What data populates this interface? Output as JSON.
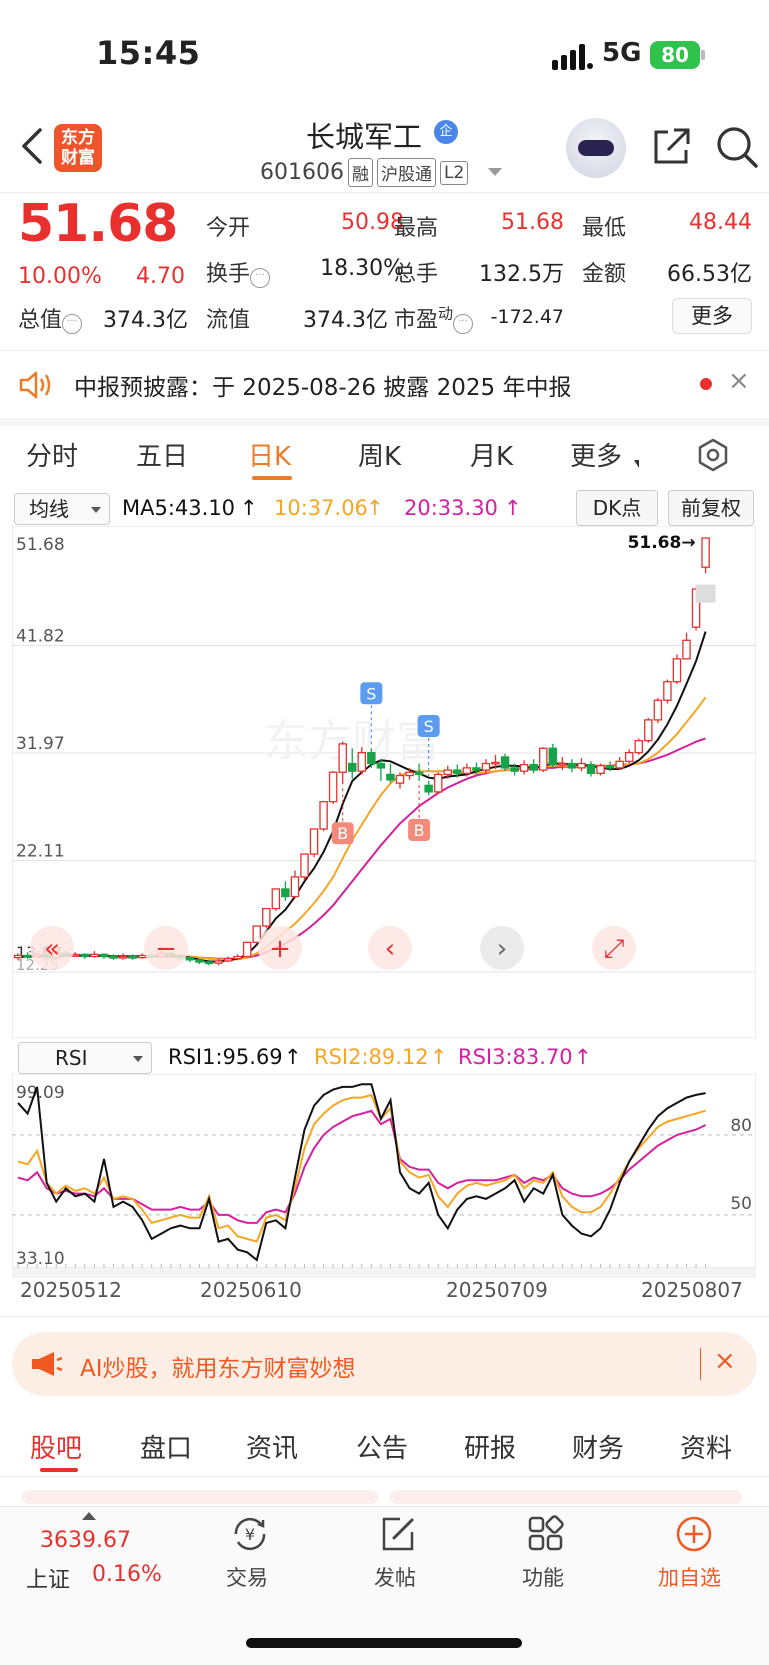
{
  "status_bar": {
    "time": "15:45",
    "network": "5G",
    "battery": "80"
  },
  "header": {
    "logo_line1": "东方",
    "logo_line2": "财富",
    "stock_name": "长城军工",
    "badge": "企",
    "stock_code": "601606",
    "tags": [
      "融",
      "沪股通",
      "L2"
    ]
  },
  "quote": {
    "price": "51.68",
    "change_pct": "10.00%",
    "change_amt": "4.70",
    "fields": [
      {
        "label": "今开",
        "value": "50.98",
        "color": "#e8312f"
      },
      {
        "label": "最高",
        "value": "51.68",
        "color": "#e8312f"
      },
      {
        "label": "最低",
        "value": "48.44",
        "color": "#e8312f"
      },
      {
        "label": "换手",
        "value": "18.30%",
        "color": "#222222"
      },
      {
        "label": "总手",
        "value": "132.5万",
        "color": "#222222"
      },
      {
        "label": "金额",
        "value": "66.53亿",
        "color": "#222222"
      },
      {
        "label": "总值",
        "value": "374.3亿",
        "color": "#222222"
      },
      {
        "label": "流值",
        "value": "374.3亿",
        "color": "#222222"
      },
      {
        "label": "市盈",
        "value": "-172.47",
        "color": "#222222"
      }
    ],
    "pe_superscript": "动",
    "more_button": "更多"
  },
  "notice": {
    "text": "中报预披露：于 2025-08-26 披露 2025 年中报",
    "close": "×"
  },
  "chart_tabs": [
    "分时",
    "五日",
    "日K",
    "周K",
    "月K",
    "更多"
  ],
  "active_chart_tab": "日K",
  "kline_header": {
    "select": "均线",
    "ma5": "MA5:43.10",
    "ma10": "10:37.06",
    "ma20": "20:33.30",
    "dk_button": "DK点",
    "adjust_button": "前复权"
  },
  "rsi_header": {
    "select": "RSI",
    "rsi1": "RSI1:95.69",
    "rsi2": "RSI2:89.12",
    "rsi3": "RSI3:83.70"
  },
  "colors": {
    "up": "#e8312f",
    "down": "#17a34a",
    "ma5": "#111111",
    "ma10": "#f5a623",
    "ma20": "#d61f9e",
    "accent": "#f07a26"
  },
  "chart_data": [
    {
      "type": "candlestick",
      "y_ticks": [
        "51.68",
        "41.82",
        "31.97",
        "22.11"
      ],
      "ylim": [
        12.25,
        51.68
      ],
      "last_price_label": "51.68",
      "partial_left_labels": [
        "13.83",
        "12.25"
      ],
      "signals": [
        {
          "type": "B",
          "index": 34
        },
        {
          "type": "S",
          "index": 37
        },
        {
          "type": "B",
          "index": 42
        },
        {
          "type": "S",
          "index": 43
        }
      ],
      "candles": [
        [
          13.2,
          13.4,
          13.6,
          13.0
        ],
        [
          13.4,
          13.3,
          13.7,
          13.1
        ],
        [
          13.3,
          13.5,
          13.8,
          13.2
        ],
        [
          13.5,
          13.2,
          13.6,
          13.0
        ],
        [
          13.2,
          13.6,
          13.9,
          13.1
        ],
        [
          13.6,
          13.4,
          13.8,
          13.2
        ],
        [
          13.4,
          13.5,
          13.7,
          13.3
        ],
        [
          13.5,
          13.3,
          13.6,
          13.1
        ],
        [
          13.3,
          13.5,
          13.8,
          13.2
        ],
        [
          13.5,
          13.3,
          13.6,
          13.1
        ],
        [
          13.3,
          13.2,
          13.5,
          13.0
        ],
        [
          13.2,
          13.3,
          13.6,
          13.0
        ],
        [
          13.3,
          13.2,
          13.5,
          13.0
        ],
        [
          13.2,
          13.4,
          13.6,
          13.1
        ],
        [
          13.4,
          13.3,
          13.6,
          13.1
        ],
        [
          13.3,
          13.6,
          14.0,
          13.2
        ],
        [
          13.6,
          13.4,
          13.7,
          13.2
        ],
        [
          13.4,
          13.2,
          13.5,
          13.0
        ],
        [
          13.2,
          13.0,
          13.3,
          12.8
        ],
        [
          13.0,
          12.8,
          13.1,
          12.6
        ],
        [
          12.8,
          12.7,
          13.0,
          12.5
        ],
        [
          12.7,
          12.9,
          13.1,
          12.5
        ],
        [
          12.9,
          13.1,
          13.3,
          12.8
        ],
        [
          13.1,
          13.3,
          13.5,
          13.0
        ],
        [
          13.3,
          14.6,
          14.6,
          13.2
        ],
        [
          14.6,
          16.1,
          16.1,
          14.5
        ],
        [
          16.1,
          17.7,
          17.7,
          15.9
        ],
        [
          17.7,
          19.5,
          19.5,
          17.5
        ],
        [
          19.5,
          18.8,
          20.2,
          18.4
        ],
        [
          18.8,
          20.6,
          21.2,
          18.6
        ],
        [
          20.6,
          22.7,
          22.7,
          20.3
        ],
        [
          22.7,
          25.0,
          25.0,
          22.4
        ],
        [
          25.0,
          27.5,
          27.5,
          24.8
        ],
        [
          27.5,
          30.2,
          30.3,
          27.3
        ],
        [
          30.2,
          32.8,
          33.0,
          29.1
        ],
        [
          31.0,
          30.3,
          32.4,
          29.6
        ],
        [
          30.3,
          32.0,
          32.5,
          30.0
        ],
        [
          32.0,
          31.0,
          32.4,
          30.6
        ],
        [
          31.0,
          30.6,
          31.4,
          29.4
        ],
        [
          30.0,
          29.5,
          31.0,
          29.2
        ],
        [
          29.2,
          29.9,
          30.2,
          28.7
        ],
        [
          29.9,
          30.2,
          30.6,
          29.5
        ],
        [
          30.2,
          30.0,
          31.0,
          29.4
        ],
        [
          29.0,
          28.4,
          29.4,
          28.1
        ],
        [
          28.4,
          30.0,
          30.2,
          28.2
        ],
        [
          30.0,
          30.4,
          30.8,
          29.6
        ],
        [
          30.4,
          30.1,
          30.9,
          29.7
        ],
        [
          30.1,
          30.6,
          31.0,
          29.8
        ],
        [
          30.6,
          30.4,
          31.1,
          30.0
        ],
        [
          30.4,
          31.0,
          31.4,
          30.1
        ],
        [
          31.0,
          31.1,
          31.8,
          30.5
        ],
        [
          31.6,
          30.6,
          31.9,
          30.3
        ],
        [
          30.6,
          30.3,
          31.0,
          29.9
        ],
        [
          30.3,
          30.9,
          31.3,
          30.0
        ],
        [
          30.9,
          30.4,
          31.4,
          30.1
        ],
        [
          30.4,
          32.4,
          32.5,
          30.2
        ],
        [
          32.4,
          30.9,
          32.8,
          30.6
        ],
        [
          30.9,
          31.0,
          31.6,
          30.4
        ],
        [
          31.0,
          30.6,
          31.4,
          30.2
        ],
        [
          30.6,
          31.0,
          31.5,
          30.3
        ],
        [
          30.9,
          30.1,
          31.2,
          29.8
        ],
        [
          30.1,
          30.8,
          31.0,
          29.9
        ],
        [
          30.8,
          30.6,
          31.2,
          30.3
        ],
        [
          30.6,
          31.2,
          31.6,
          30.4
        ],
        [
          31.2,
          32.0,
          32.3,
          31.0
        ],
        [
          32.0,
          33.1,
          33.3,
          31.8
        ],
        [
          33.1,
          35.0,
          35.2,
          32.9
        ],
        [
          35.0,
          36.8,
          37.0,
          34.7
        ],
        [
          36.8,
          38.5,
          38.7,
          36.5
        ],
        [
          38.5,
          40.6,
          41.0,
          38.3
        ],
        [
          40.6,
          42.3,
          43.0,
          41.1
        ],
        [
          43.5,
          47.0,
          47.2,
          43.2
        ],
        [
          49.0,
          51.68,
          51.68,
          48.44
        ]
      ],
      "ma5": [
        13.3,
        13.35,
        13.4,
        13.4,
        13.4,
        13.4,
        13.4,
        13.4,
        13.4,
        13.35,
        13.3,
        13.3,
        13.3,
        13.3,
        13.3,
        13.35,
        13.4,
        13.3,
        13.2,
        13.0,
        12.85,
        12.85,
        12.95,
        13.1,
        13.5,
        14.4,
        15.6,
        16.8,
        17.6,
        18.8,
        20.2,
        21.4,
        22.9,
        24.8,
        27.3,
        29.4,
        30.2,
        30.9,
        31.3,
        31.2,
        30.8,
        30.4,
        30.1,
        29.7,
        29.6,
        29.8,
        29.9,
        30.0,
        30.3,
        30.5,
        30.7,
        30.8,
        30.8,
        30.7,
        30.6,
        30.8,
        31.0,
        31.0,
        30.9,
        30.9,
        30.8,
        30.6,
        30.5,
        30.5,
        30.8,
        31.3,
        32.1,
        33.2,
        34.6,
        36.3,
        38.3,
        40.4,
        43.1
      ],
      "ma10": [
        13.3,
        13.32,
        13.35,
        13.36,
        13.37,
        13.38,
        13.39,
        13.4,
        13.4,
        13.38,
        13.35,
        13.33,
        13.32,
        13.32,
        13.31,
        13.32,
        13.34,
        13.33,
        13.3,
        13.22,
        13.1,
        13.05,
        13.02,
        13.05,
        13.2,
        13.6,
        14.2,
        14.9,
        15.6,
        16.3,
        17.2,
        18.2,
        19.3,
        20.6,
        22.3,
        24.0,
        25.4,
        26.8,
        28.1,
        29.2,
        29.9,
        30.2,
        30.3,
        30.3,
        30.3,
        30.3,
        30.2,
        30.1,
        30.1,
        30.2,
        30.3,
        30.4,
        30.5,
        30.6,
        30.6,
        30.7,
        30.8,
        30.8,
        30.8,
        30.8,
        30.8,
        30.8,
        30.8,
        30.8,
        30.9,
        31.0,
        31.4,
        32.0,
        32.8,
        33.7,
        34.8,
        35.9,
        37.06
      ],
      "ma20": [
        13.3,
        13.31,
        13.32,
        13.33,
        13.34,
        13.35,
        13.35,
        13.36,
        13.36,
        13.36,
        13.35,
        13.34,
        13.33,
        13.32,
        13.31,
        13.3,
        13.3,
        13.28,
        13.25,
        13.2,
        13.15,
        13.1,
        13.1,
        13.12,
        13.2,
        13.4,
        13.7,
        14.1,
        14.5,
        15.0,
        15.6,
        16.3,
        17.1,
        18.0,
        19.1,
        20.2,
        21.3,
        22.4,
        23.5,
        24.5,
        25.5,
        26.3,
        27.1,
        27.7,
        28.3,
        28.8,
        29.2,
        29.6,
        29.9,
        30.1,
        30.3,
        30.4,
        30.5,
        30.5,
        30.5,
        30.6,
        30.6,
        30.7,
        30.7,
        30.7,
        30.8,
        30.8,
        30.8,
        30.9,
        30.9,
        31.0,
        31.2,
        31.5,
        31.8,
        32.2,
        32.6,
        33.0,
        33.3
      ]
    },
    {
      "type": "line",
      "y_ticks": [
        "99.09",
        "33.10"
      ],
      "right_labels": [
        "80",
        "50"
      ],
      "ylim": [
        33.1,
        99.09
      ],
      "x_labels": [
        "20250512",
        "20250610",
        "20250709",
        "20250807"
      ],
      "series": [
        {
          "name": "RSI1",
          "color": "#111111",
          "values": [
            92,
            88,
            98,
            62,
            55,
            60,
            57,
            58,
            55,
            71,
            53,
            55,
            53,
            48,
            41,
            43,
            45,
            46,
            45,
            45,
            56,
            40,
            41,
            37,
            36,
            33,
            47,
            48,
            45,
            64,
            82,
            91,
            95,
            97,
            98,
            98,
            99,
            99,
            86,
            93,
            66,
            60,
            58,
            62,
            50,
            45,
            52,
            56,
            57,
            56,
            58,
            60,
            63,
            55,
            60,
            58,
            65,
            50,
            46,
            43,
            42,
            45,
            52,
            62,
            70,
            76,
            82,
            87,
            90,
            92,
            94,
            95,
            95.69
          ]
        },
        {
          "name": "RSI2",
          "color": "#f5a623",
          "values": [
            70,
            69,
            74,
            62,
            58,
            61,
            59,
            60,
            58,
            64,
            56,
            57,
            56,
            52,
            47,
            48,
            49,
            50,
            49,
            49,
            57,
            45,
            46,
            42,
            41,
            40,
            49,
            50,
            48,
            60,
            75,
            84,
            88,
            91,
            93,
            94,
            94,
            95,
            86,
            90,
            70,
            66,
            64,
            65,
            57,
            53,
            58,
            61,
            62,
            61,
            62,
            63,
            65,
            60,
            63,
            62,
            66,
            57,
            53,
            51,
            51,
            53,
            58,
            64,
            70,
            75,
            79,
            83,
            85,
            86,
            87,
            88,
            89.12
          ]
        },
        {
          "name": "RSI3",
          "color": "#d61f9e",
          "values": [
            64,
            63,
            66,
            60,
            58,
            59,
            58,
            58,
            57,
            60,
            56,
            56,
            56,
            54,
            52,
            52,
            52,
            53,
            52,
            52,
            55,
            50,
            50,
            48,
            47,
            47,
            51,
            52,
            51,
            58,
            68,
            75,
            80,
            83,
            85,
            87,
            88,
            89,
            84,
            86,
            71,
            68,
            67,
            67,
            62,
            60,
            62,
            63,
            63,
            63,
            63,
            64,
            65,
            62,
            64,
            63,
            65,
            60,
            58,
            57,
            57,
            58,
            60,
            63,
            67,
            70,
            73,
            76,
            78,
            80,
            81,
            82,
            83.7
          ]
        }
      ]
    }
  ],
  "ai_banner": {
    "text": "AI炒股，就用东方财富妙想",
    "close": "×"
  },
  "bottom_tabs": [
    "股吧",
    "盘口",
    "资讯",
    "公告",
    "研报",
    "财务",
    "资料"
  ],
  "index": {
    "value": "3639.67",
    "name": "上证",
    "pct": "0.16%"
  },
  "nav": [
    {
      "label": "交易",
      "icon": "yen-exchange-icon"
    },
    {
      "label": "发帖",
      "icon": "edit-icon"
    },
    {
      "label": "功能",
      "icon": "grid-icon"
    },
    {
      "label": "加自选",
      "icon": "plus-circle-icon"
    }
  ]
}
